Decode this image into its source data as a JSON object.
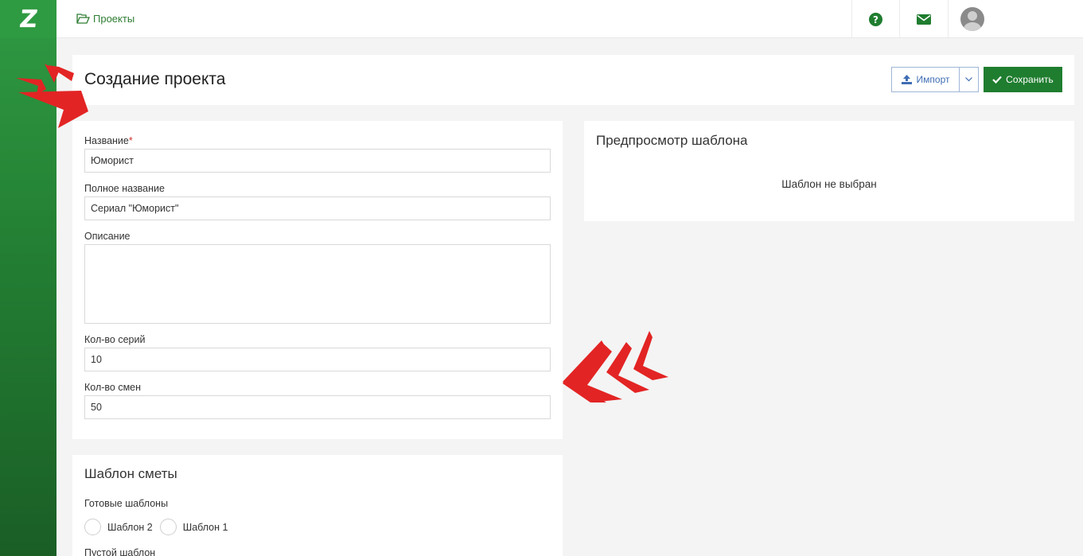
{
  "app": {
    "logo_text": "Z",
    "brand_color": "#2e9a41"
  },
  "topbar": {
    "breadcrumb": "Проекты",
    "icons": [
      "folder-open-icon",
      "question-circle-icon",
      "envelope-icon",
      "user-avatar"
    ]
  },
  "header": {
    "title": "Создание проекта",
    "import_label": "Импорт",
    "save_label": "Сохранить"
  },
  "form": {
    "name_label": "Название",
    "name_required": "*",
    "name_value": "Юморист",
    "fullname_label": "Полное название",
    "fullname_value": "Сериал \"Юморист\"",
    "description_label": "Описание",
    "description_value": "",
    "series_label": "Кол-во серий",
    "series_value": "10",
    "shifts_label": "Кол-во смен",
    "shifts_value": "50"
  },
  "preview": {
    "title": "Предпросмотр шаблона",
    "empty_text": "Шаблон не выбран"
  },
  "estimate": {
    "title": "Шаблон сметы",
    "ready_label": "Готовые шаблоны",
    "templates": [
      "Шаблон 2",
      "Шаблон 1"
    ],
    "empty_label": "Пустой шаблон"
  }
}
